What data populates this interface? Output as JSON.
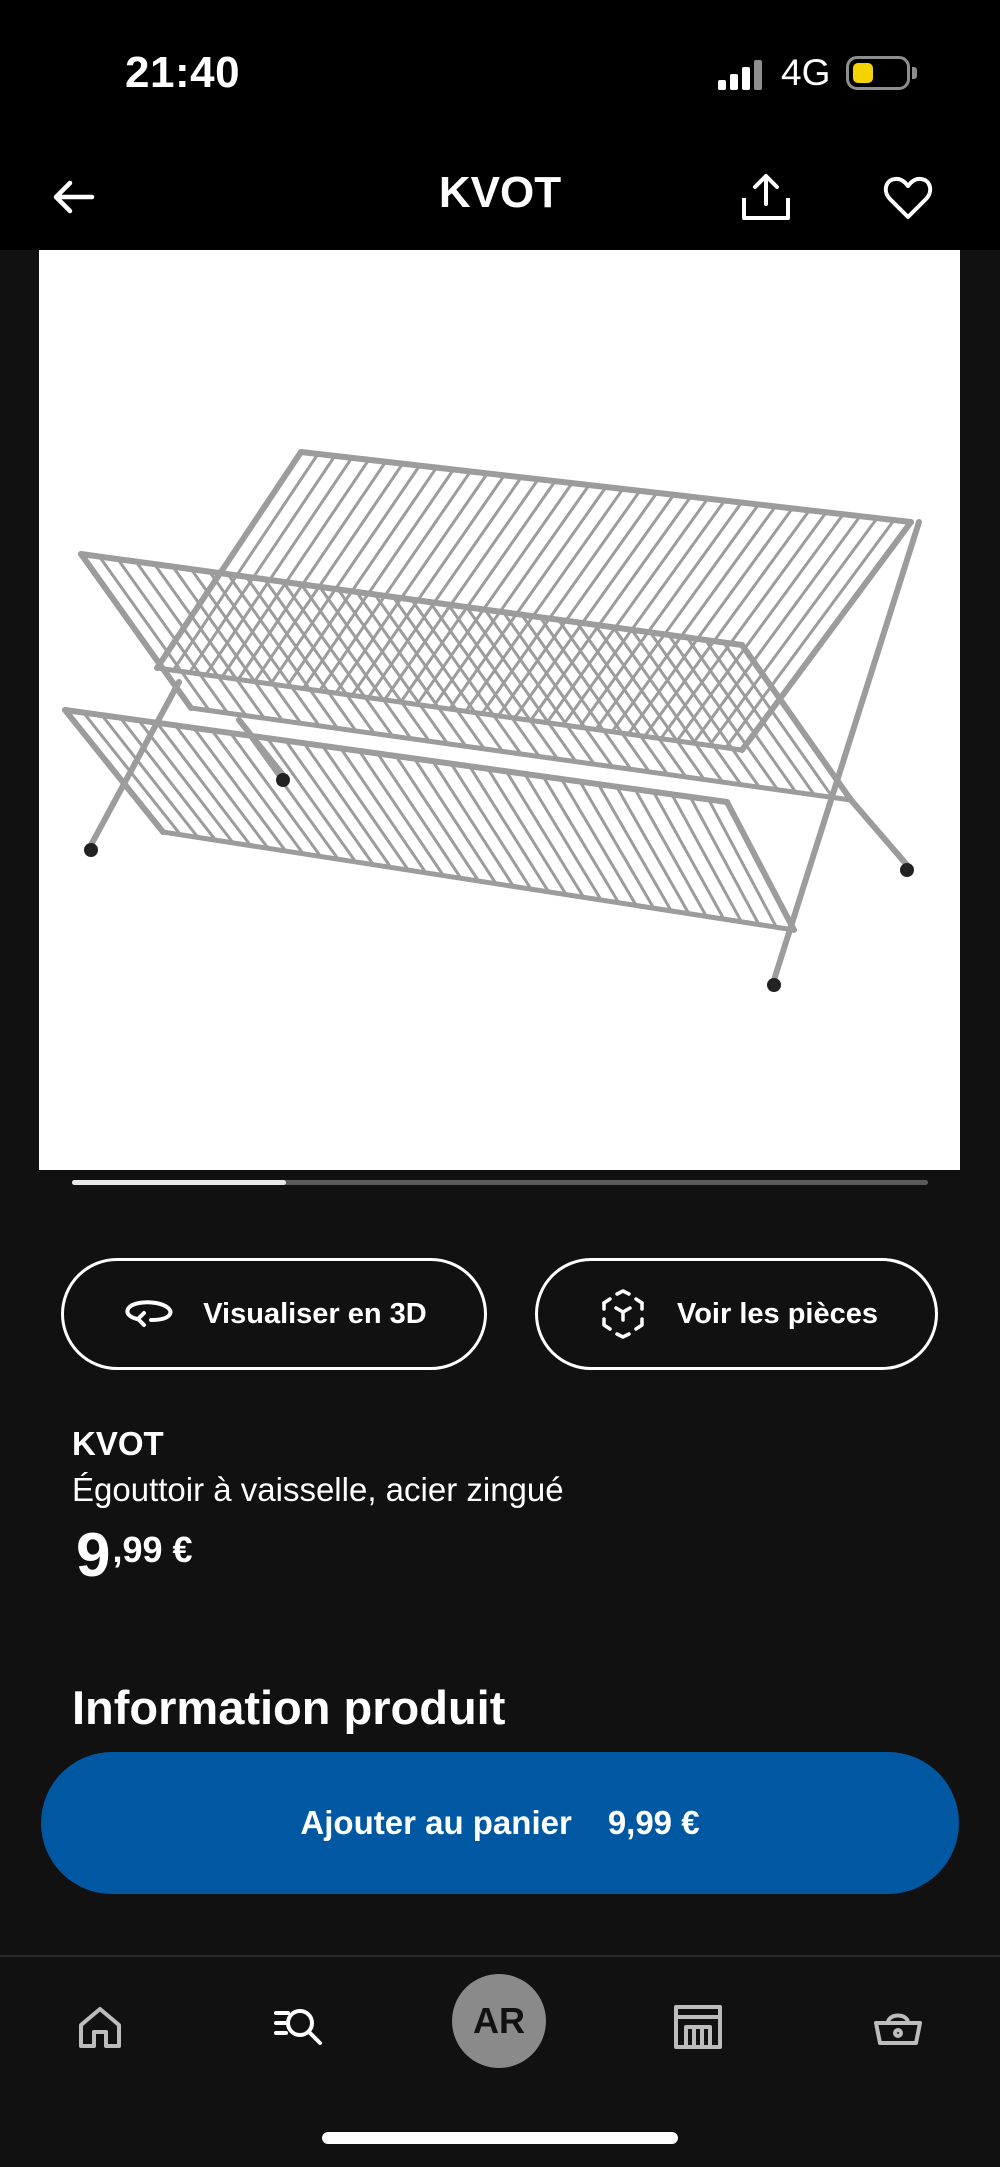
{
  "status_bar": {
    "time": "21:40",
    "network": "4G",
    "battery_color": "#f5d300"
  },
  "nav": {
    "title": "KVOT",
    "back_icon": "arrow-left-icon",
    "share_icon": "share-icon",
    "favorite_icon": "heart-icon"
  },
  "product_image": {
    "subject": "folding dish drainer, galvanized steel"
  },
  "carousel": {
    "progress": 0.25
  },
  "actions": {
    "view_3d_label": "Visualiser en 3D",
    "view_parts_label": "Voir les pièces"
  },
  "product": {
    "name": "KVOT",
    "description": "Égouttoir à vaisselle, acier zingué",
    "price_integer": "9",
    "price_decimal": ",99 €",
    "section_title": "Information produit"
  },
  "cart_button": {
    "label": "Ajouter au panier",
    "price": "9,99 €",
    "color": "#0058a3"
  },
  "bottom_nav": {
    "ar_label": "AR",
    "items": [
      "home-icon",
      "search-icon",
      "ar-button",
      "store-icon",
      "basket-icon"
    ]
  }
}
